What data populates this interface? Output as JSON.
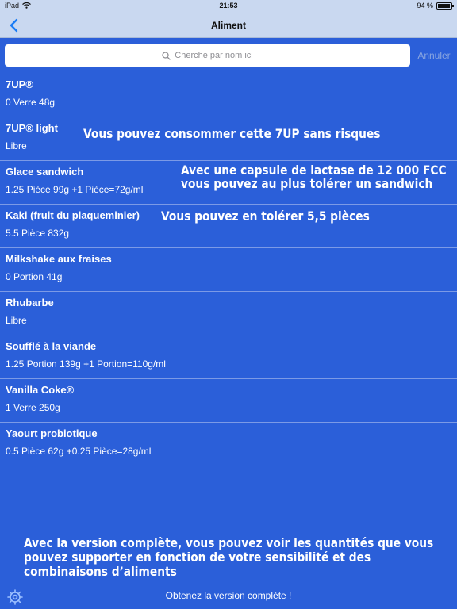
{
  "status_bar": {
    "device": "iPad",
    "time": "21:53",
    "battery": "94 %",
    "battery_level": 0.94
  },
  "nav": {
    "title": "Aliment"
  },
  "search": {
    "placeholder": "Cherche par nom ici",
    "cancel_label": "Annuler"
  },
  "items": [
    {
      "name": "7UP®",
      "detail": "0 Verre 48g"
    },
    {
      "name": "7UP® light",
      "detail": "Libre"
    },
    {
      "name": "Glace sandwich",
      "detail": "1.25 Pièce 99g +1 Pièce=72g/ml"
    },
    {
      "name": "Kaki (fruit du plaqueminier)",
      "detail": "5.5 Pièce 832g"
    },
    {
      "name": "Milkshake aux fraises",
      "detail": "0 Portion 41g"
    },
    {
      "name": "Rhubarbe",
      "detail": "Libre"
    },
    {
      "name": "Soufflé à la viande",
      "detail": "1.25 Portion 139g +1 Portion=110g/ml"
    },
    {
      "name": "Vanilla Coke®",
      "detail": "1 Verre 250g"
    },
    {
      "name": "Yaourt probiotique",
      "detail": "0.5 Pièce 62g +0.25 Pièce=28g/ml"
    }
  ],
  "annotations": {
    "note_7up_light": "Vous pouvez consommer cette 7UP sans risques",
    "note_glace_line1": "Avec une capsule de lactase de 12 000 FCC",
    "note_glace_line2": "vous pouvez au plus  tolérer un sandwich",
    "note_kaki": "Vous pouvez en tolérer 5,5 pièces"
  },
  "promo": {
    "line1": "Avec la version complète, vous pouvez voir les quantités que vous",
    "line2": "pouvez supporter en fonction de votre sensibilité et des",
    "line3": "combinaisons d’aliments"
  },
  "bottom_bar": {
    "full_version_label": "Obtenez la version complète !"
  },
  "colors": {
    "accent": "#2b5fd9",
    "bar_background": "#c9d8f0",
    "ios_blue": "#1a7cf5"
  },
  "icons": {
    "back": "chevron-left-icon",
    "search": "search-icon",
    "settings": "gear-icon",
    "wifi": "wifi-icon",
    "battery": "battery-icon"
  }
}
